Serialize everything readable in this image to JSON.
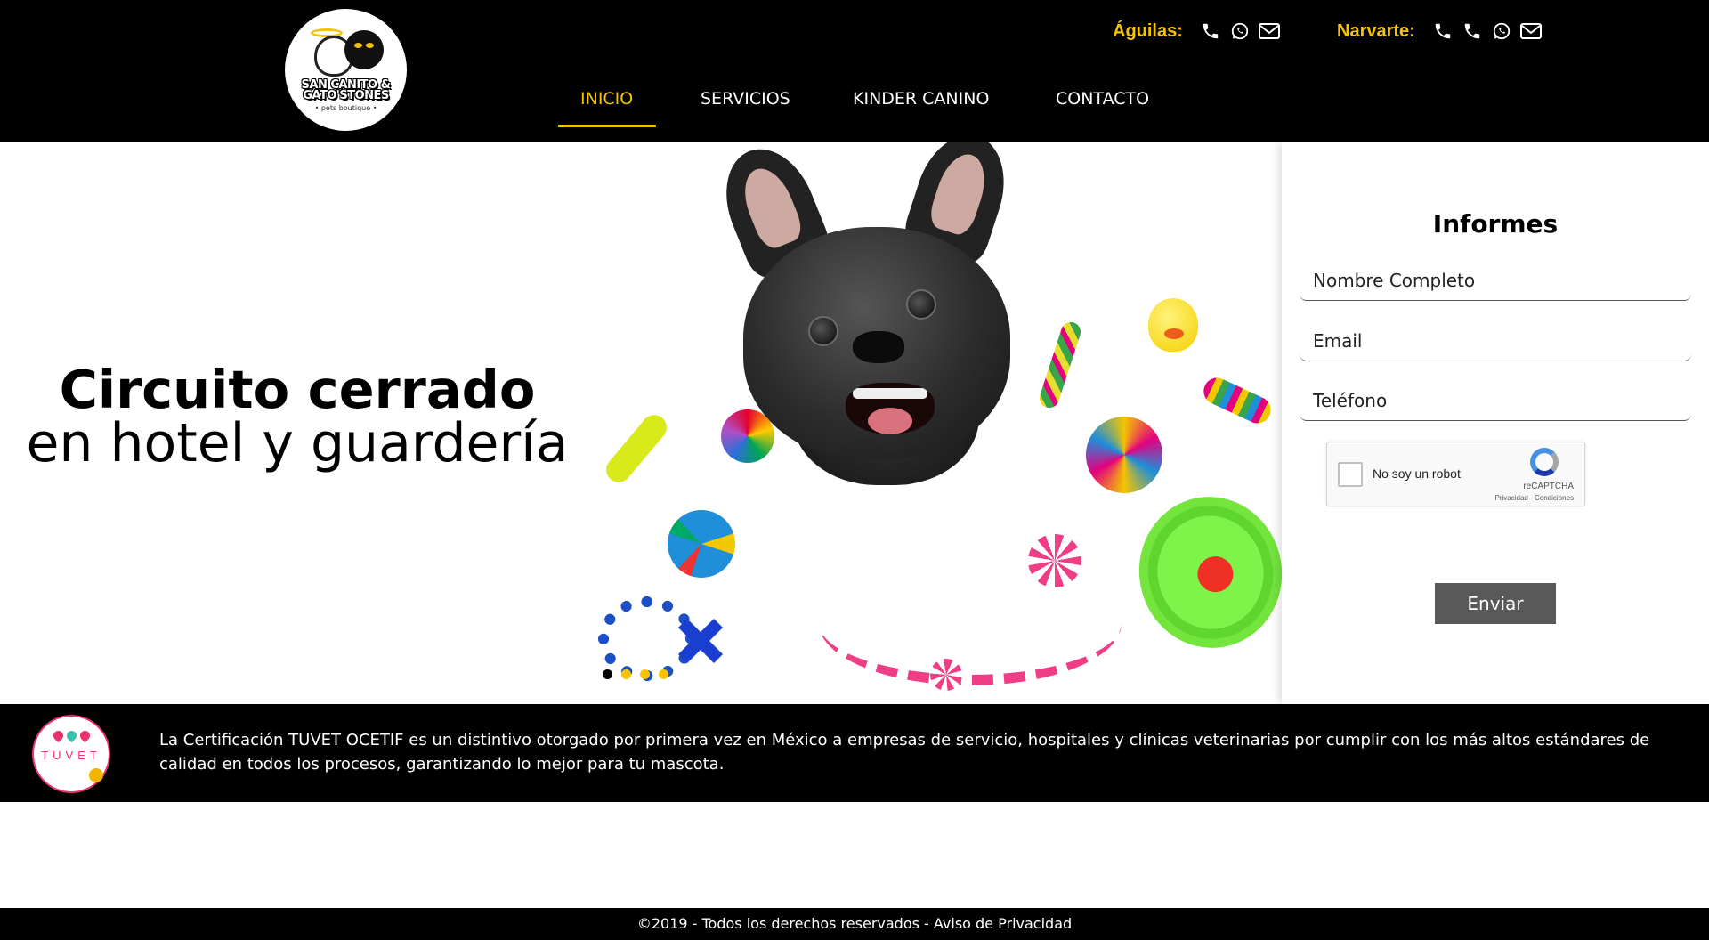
{
  "brand": {
    "logo_line1": "SAN CANITO &",
    "logo_line2": "GATO'STONES",
    "logo_sub": "• pets boutique •"
  },
  "contacts": [
    {
      "label": "Águilas:",
      "icons": [
        "phone-icon",
        "whatsapp-icon",
        "mail-icon"
      ]
    },
    {
      "label": "Narvarte:",
      "icons": [
        "phone-icon",
        "phone-icon",
        "whatsapp-icon",
        "mail-icon"
      ]
    }
  ],
  "nav": {
    "items": [
      "INICIO",
      "SERVICIOS",
      "KINDER CANINO",
      "CONTACTO"
    ],
    "active": "INICIO"
  },
  "hero": {
    "title_bold": "Circuito cerrado",
    "title_light": "en hotel y guardería",
    "slides_count": 4,
    "active_slide": 1
  },
  "form": {
    "title": "Informes",
    "name_placeholder": "Nombre Completo",
    "email_placeholder": "Email",
    "phone_placeholder": "Teléfono",
    "captcha_label": "No soy un robot",
    "captcha_brand": "reCAPTCHA",
    "captcha_links": "Privacidad - Condiciones",
    "submit_label": "Enviar"
  },
  "certification": {
    "badge_text": "TUVET",
    "text": "La Certificación TUVET OCETIF es un distintivo otorgado por primera vez en México a empresas de servicio, hospitales y clínicas veterinarias por cumplir con los más altos estándares de calidad en todos los procesos, garantizando lo mejor para tu mascota."
  },
  "footer": {
    "copyright": "©2019 - Todos los derechos reservados - ",
    "privacy_link": "Aviso de Privacidad"
  },
  "colors": {
    "accent": "#f6c400",
    "header_bg": "#000000",
    "button_bg": "#595959"
  }
}
